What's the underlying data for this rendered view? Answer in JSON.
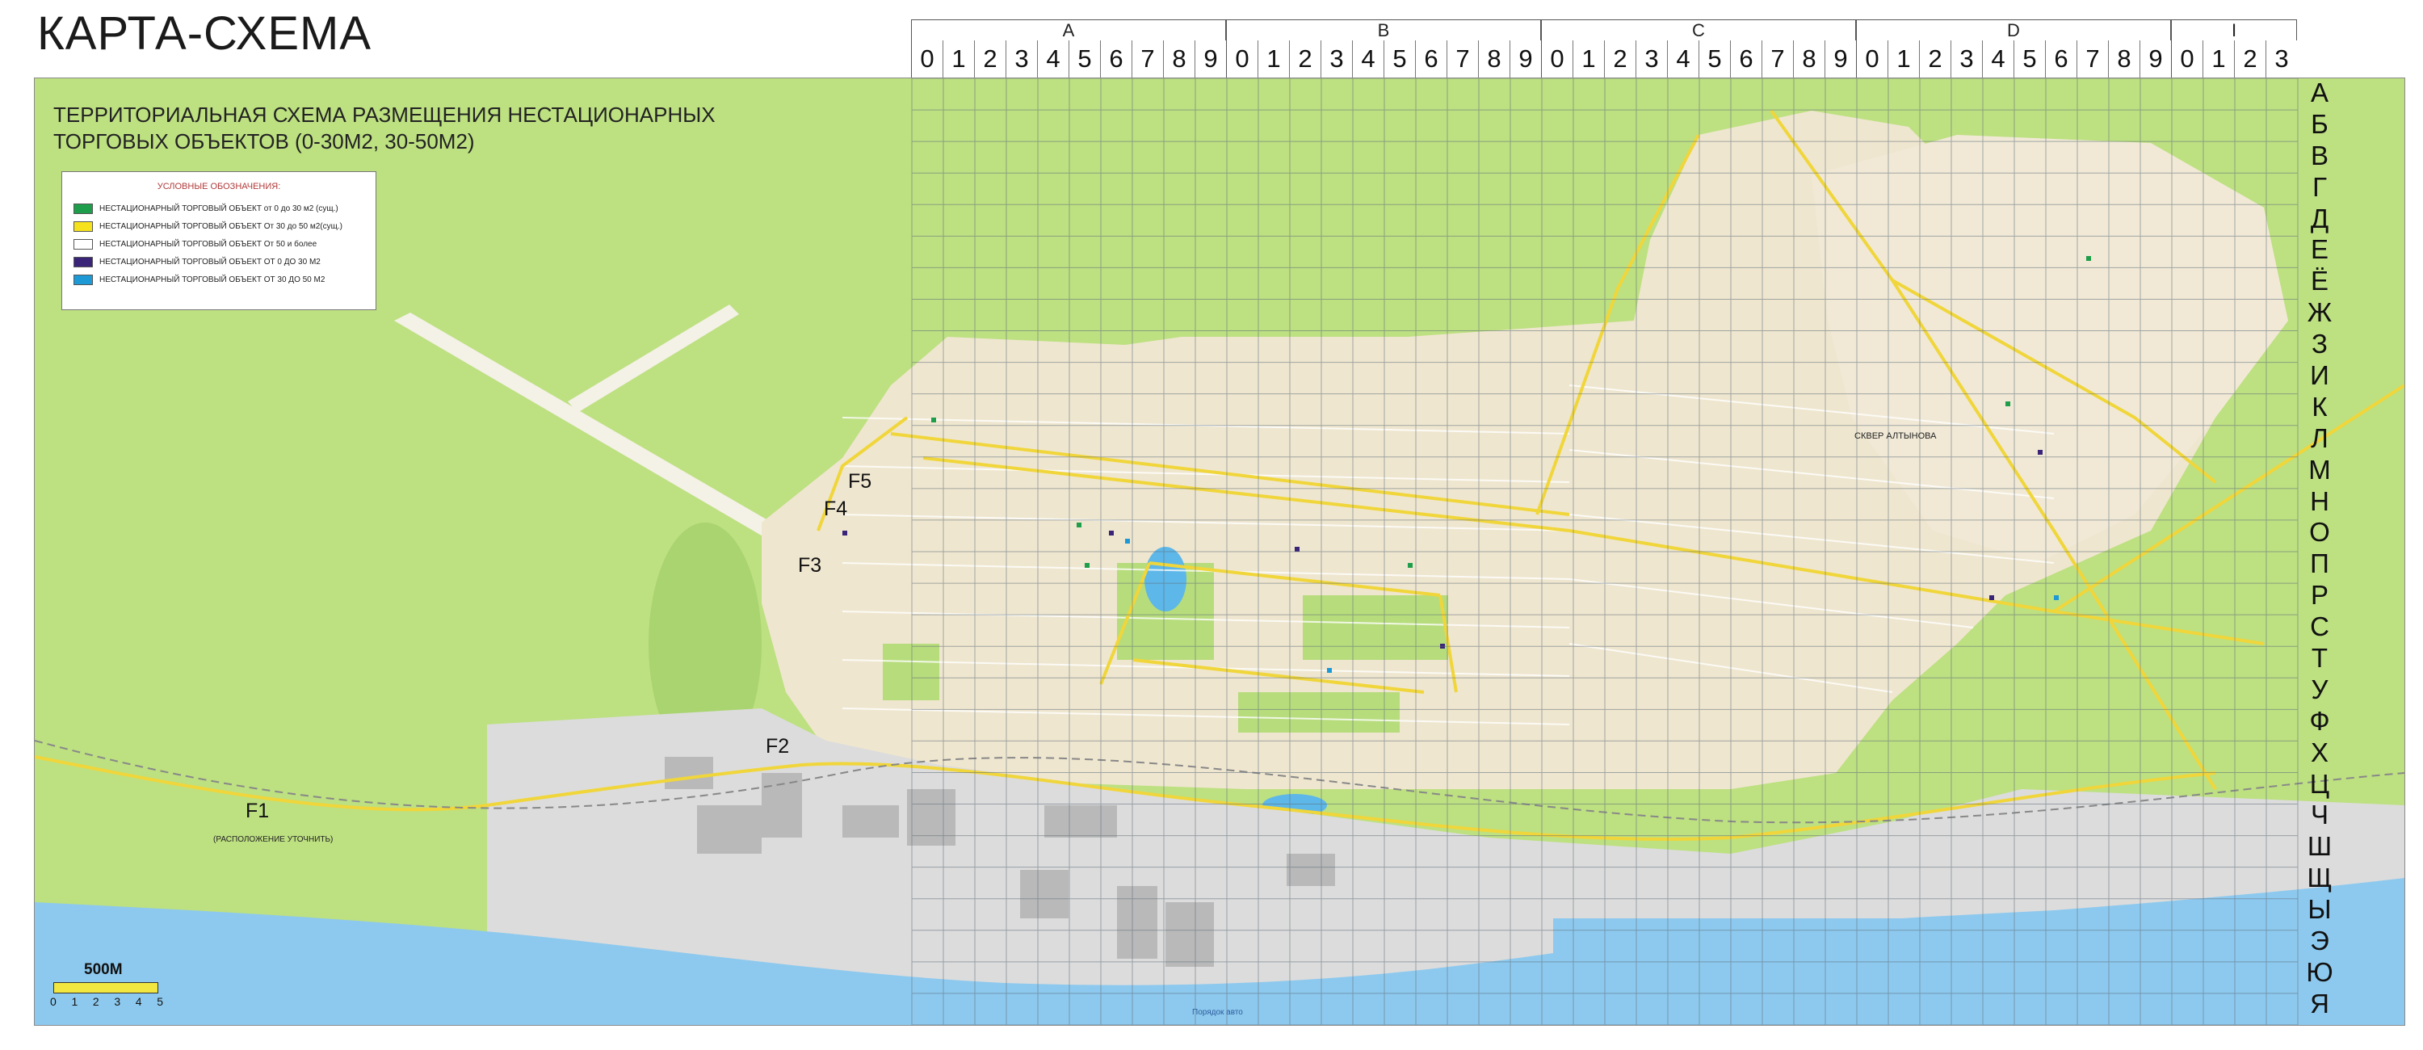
{
  "page": {
    "title": "КАРТА-СХЕМА"
  },
  "map": {
    "subtitle_line1": "ТЕРРИТОРИАЛЬНАЯ СХЕМА РАЗМЕЩЕНИЯ НЕСТАЦИОНАРНЫХ",
    "subtitle_line2": "ТОРГОВЫХ ОБЪЕКТОВ (0-30М2, 30-50М2)",
    "legend": {
      "title": "УСЛОВНЫЕ ОБОЗНАЧЕНИЯ:",
      "items": [
        {
          "label": "НЕСТАЦИОНАРНЫЙ ТОРГОВЫЙ ОБЪЕКТ от 0 до 30 м2 (сущ.)",
          "color": "#1e9e4a"
        },
        {
          "label": "НЕСТАЦИОНАРНЫЙ ТОРГОВЫЙ ОБЪЕКТ От 30 до 50 м2(сущ.)",
          "color": "#f5e21c"
        },
        {
          "label": "НЕСТАЦИОНАРНЫЙ ТОРГОВЫЙ ОБЪЕКТ От 50 и более",
          "color": "#ffffff"
        },
        {
          "label": "НЕСТАЦИОНАРНЫЙ ТОРГОВЫЙ ОБЪЕКТ ОТ 0 ДО 30 М2",
          "color": "#3a2478"
        },
        {
          "label": "НЕСТАЦИОНАРНЫЙ ТОРГОВЫЙ ОБЪЕКТ ОТ 30 ДО 50 М2",
          "color": "#1d9ad6"
        }
      ]
    },
    "grid": {
      "column_groups": [
        "A",
        "B",
        "C",
        "D",
        "I"
      ],
      "column_digits": [
        [
          "0",
          "1",
          "2",
          "3",
          "4",
          "5",
          "6",
          "7",
          "8",
          "9"
        ],
        [
          "0",
          "1",
          "2",
          "3",
          "4",
          "5",
          "6",
          "7",
          "8",
          "9"
        ],
        [
          "0",
          "1",
          "2",
          "3",
          "4",
          "5",
          "6",
          "7",
          "8",
          "9"
        ],
        [
          "0",
          "1",
          "2",
          "3",
          "4",
          "5",
          "6",
          "7",
          "8",
          "9"
        ],
        [
          "0",
          "1",
          "2",
          "3"
        ]
      ],
      "row_labels": [
        "А",
        "Б",
        "В",
        "Г",
        "Д",
        "Е",
        "Ё",
        "Ж",
        "З",
        "И",
        "К",
        "Л",
        "М",
        "Н",
        "О",
        "П",
        "Р",
        "С",
        "Т",
        "У",
        "Ф",
        "Х",
        "Ц",
        "Ч",
        "Ш",
        "Щ",
        "Ы",
        "Э",
        "Ю",
        "Я"
      ]
    },
    "zones": [
      "F1",
      "F2",
      "F3",
      "F4",
      "F5"
    ],
    "notes": {
      "f1_note": "(РАСПОЛОЖЕНИЕ УТОЧНИТЬ)"
    },
    "place_labels": {
      "square": "СКВЕР АЛТЫНОВА",
      "bottom_tag": "Порядок авто"
    },
    "scale": {
      "label": "500М",
      "ticks": [
        "0",
        "1",
        "2",
        "3",
        "4",
        "5"
      ]
    },
    "colors": {
      "forest": "#bde081",
      "urban": "#efe6cf",
      "industrial": "#d9d9d9",
      "water": "#8dc9ee",
      "road": "#f0d63a",
      "grid": "#5f6f7a"
    }
  }
}
